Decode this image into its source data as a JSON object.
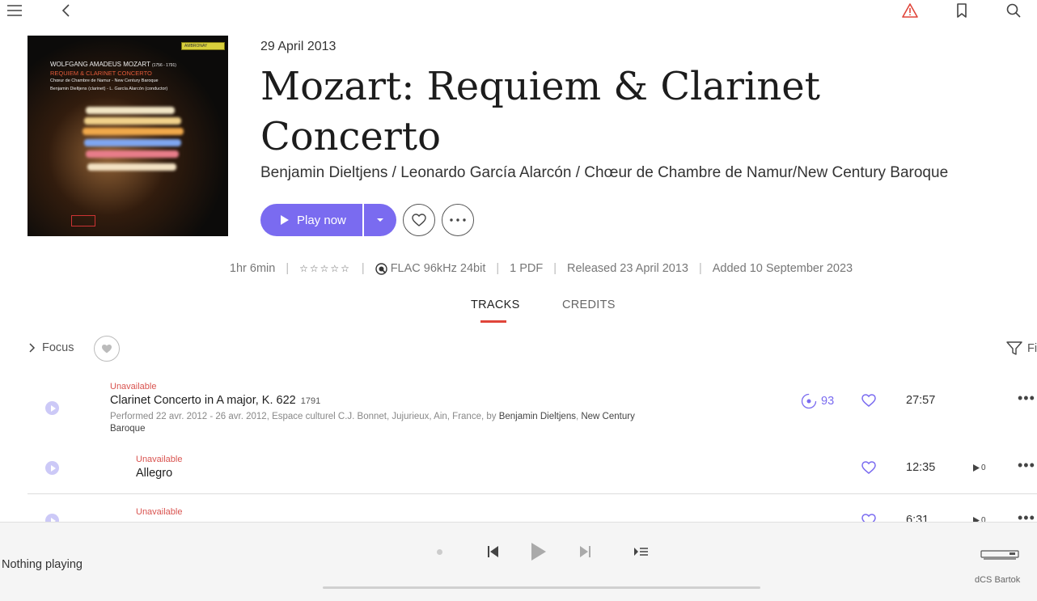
{
  "top_bar": {
    "icons": [
      "menu-icon",
      "back-icon",
      "warning-icon",
      "bookmark-icon",
      "search-icon"
    ],
    "warning_color": "#e0453a"
  },
  "album": {
    "cover": {
      "composer_line": "WOLFGANG AMADEUS MOZART",
      "composer_years": "(1756 - 1791)",
      "work_line": "REQUIEM & CLARINET CONCERTO",
      "performers_line_1": "Chœur de Chambre de Namur - New Century Baroque",
      "performers_line_2": "Benjamin Dieltjens (clarinet) - L. García Alarcón (conductor)",
      "label_text": "AMBRONAY"
    },
    "date": "29 April 2013",
    "title": "Mozart: Requiem & Clarinet Concerto",
    "artists": "Benjamin Dieltjens / Leonardo García Alarcón / Chœur de Chambre de Namur/New Century Baroque"
  },
  "actions": {
    "play_label": "Play now",
    "accent": "#7a6bf0"
  },
  "info": {
    "duration": "1hr 6min",
    "rating_stars": "☆☆☆☆☆",
    "quality": "FLAC 96kHz 24bit",
    "pdf": "1 PDF",
    "released": "Released 23 April 2013",
    "added": "Added 10 September 2023"
  },
  "tabs": [
    {
      "label": "TRACKS",
      "active": true
    },
    {
      "label": "CREDITS",
      "active": false
    }
  ],
  "toolbar": {
    "focus_label": "Focus",
    "filter_label": "Fi"
  },
  "work": {
    "status": "Unavailable",
    "title": "Clarinet Concerto in A major, K. 622",
    "year": "1791",
    "performed_prefix": "Performed 22 avr. 2012 - 26 avr. 2012, Espace culturel C.J. Bonnet, Jujurieux, Ain, France, by ",
    "performer_1": "Benjamin Dieltjens",
    "performer_sep": ", ",
    "performer_2": "New Century Baroque",
    "listens": "93",
    "duration": "27:57"
  },
  "tracks": [
    {
      "status": "Unavailable",
      "title": "Allegro",
      "duration": "12:35",
      "plays": "0"
    },
    {
      "status": "Unavailable",
      "title": "",
      "duration": "6:31",
      "plays": "0"
    }
  ],
  "player": {
    "status": "Nothing playing",
    "device": "dCS Bartok"
  }
}
